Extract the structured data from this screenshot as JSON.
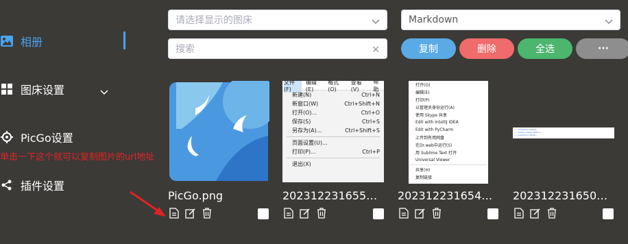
{
  "sidebar": {
    "items": [
      {
        "label": "相册",
        "icon": "image-icon"
      },
      {
        "label": "图床设置",
        "icon": "grid-icon"
      },
      {
        "label": "PicGo设置",
        "icon": "gear-icon"
      },
      {
        "label": "插件设置",
        "icon": "share-icon"
      }
    ],
    "annotation": "单击一下这个就可以复制图片的url地址"
  },
  "toolbar": {
    "bed_select_placeholder": "请选择显示的图床",
    "format_select_value": "Markdown",
    "search_placeholder": "搜索",
    "copy_label": "复制",
    "delete_label": "删除",
    "select_all_label": "全选",
    "more_label": "···"
  },
  "colors": {
    "copy": "#5aabe5",
    "delete": "#f06b6b",
    "select_all": "#4cb56e",
    "more": "#8e8e8e",
    "active": "#4aa3ef"
  },
  "gallery": {
    "items": [
      {
        "name": "PicGo.png"
      },
      {
        "name": "20231223165563.png"
      },
      {
        "name": "20231223165404.png"
      },
      {
        "name": "20231223165041.png"
      }
    ],
    "menu_shot": {
      "menubar": [
        "文件(F)",
        "编辑(E)",
        "格式(O)",
        "查看(V)",
        "帮助"
      ],
      "rows": [
        {
          "l": "新建(N)",
          "r": "Ctrl+N"
        },
        {
          "l": "新窗口(W)",
          "r": "Ctrl+Shift+N"
        },
        {
          "l": "打开(O)...",
          "r": "Ctrl+O"
        },
        {
          "l": "保存(S)",
          "r": "Ctrl+S"
        },
        {
          "l": "另存为(A)...",
          "r": "Ctrl+Shift+S"
        },
        {
          "sep": true
        },
        {
          "l": "页面设置(U)...",
          "r": ""
        },
        {
          "l": "打印(P)...",
          "r": "Ctrl+P"
        },
        {
          "sep": true
        },
        {
          "l": "退出(X)",
          "r": ""
        }
      ]
    },
    "ctx_shot": {
      "rows": [
        "打开(O)",
        "编辑(E)",
        "打印(P)",
        "以管理员身份运行(A)",
        "使用 Skype 共享",
        "Edit with IntelliJ IDEA",
        "Edit with PyCharm",
        "上传到有用网盘",
        "在Dr.web中运行(S)",
        "用 Sublime Text 打开",
        "Universal Viewer",
        "",
        "共享(H)",
        "复制链接"
      ]
    },
    "code_shot": {
      "lines": [
        "<-- Uploading Images",
        "<-- writing image  https://...",
        "<-- Loading to Writer..."
      ]
    }
  }
}
